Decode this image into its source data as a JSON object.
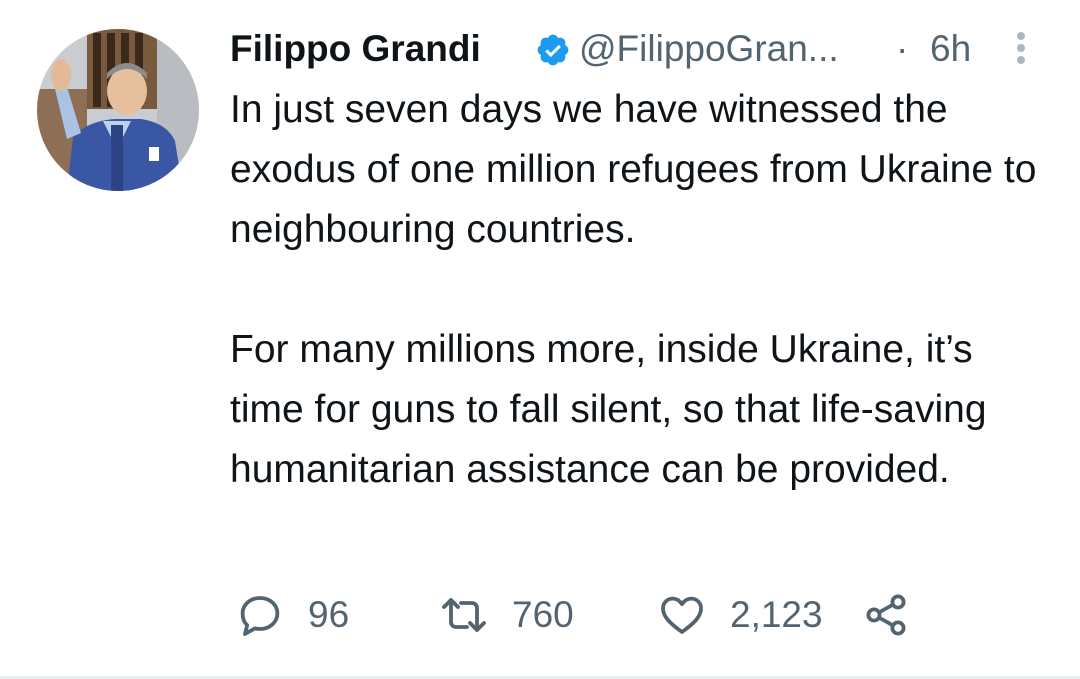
{
  "tweet": {
    "author": {
      "display_name": "Filippo Grandi",
      "handle": "@FilippoGran...",
      "verified": true,
      "avatar": "avatar-photo"
    },
    "separator": "·",
    "timestamp": "6h",
    "text_paragraphs": [
      "In just seven days we have witnessed the exodus of one million refugees from Ukraine to neighbouring countries.",
      "For many millions more, inside Ukraine, it’s time for guns to fall silent, so that life-saving humanitarian assistance can be provided."
    ],
    "actions": {
      "reply": {
        "icon": "reply-icon",
        "count": "96"
      },
      "retweet": {
        "icon": "retweet-icon",
        "count": "760"
      },
      "like": {
        "icon": "heart-icon",
        "count": "2,123"
      },
      "share": {
        "icon": "share-icon"
      }
    },
    "more_icon": "more-vertical-icon"
  },
  "colors": {
    "text_primary": "#0f1419",
    "text_secondary": "#536471",
    "verified_badge": "#1d9bf0",
    "background": "#ffffff"
  }
}
